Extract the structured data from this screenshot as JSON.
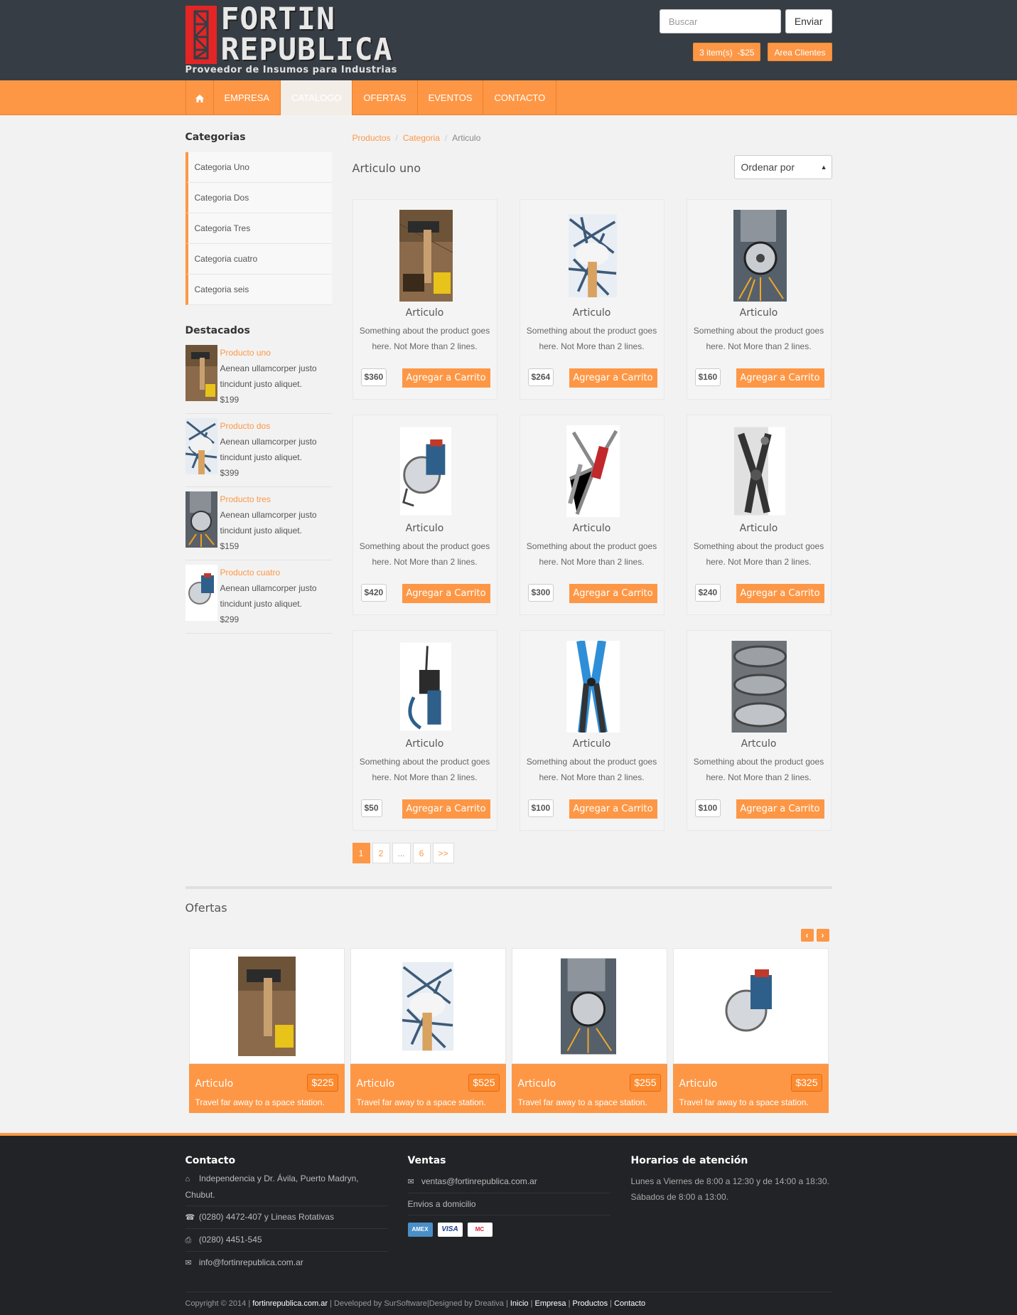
{
  "brand": {
    "name_line1": "FORTIN",
    "name_line2": "REPUBLICA",
    "tagline": "Proveedor de Insumos para Industrias"
  },
  "search": {
    "placeholder": "Buscar",
    "button": "Enviar"
  },
  "cart": {
    "label": "3 item(s)  -$25"
  },
  "clients_button": "Area Clientes",
  "nav": {
    "home_icon": "home-icon",
    "items": [
      "EMPRESA",
      "CATALOGO",
      "OFERTAS",
      "EVENTOS",
      "CONTACTO"
    ],
    "active": "CATALOGO"
  },
  "sidebar": {
    "categories_title": "Categorias",
    "categories": [
      "Categoria Uno",
      "Categoria Dos",
      "Categoria Tres",
      "Categoria cuatro",
      "Categoria seis"
    ],
    "featured_title": "Destacados",
    "featured": [
      {
        "name": "Producto uno",
        "desc": "Aenean ullamcorper justo tincidunt justo aliquet.",
        "price": "$199"
      },
      {
        "name": "Producto dos",
        "desc": "Aenean ullamcorper justo tincidunt justo aliquet.",
        "price": "$399"
      },
      {
        "name": "Producto tres",
        "desc": "Aenean ullamcorper justo tincidunt justo aliquet.",
        "price": "$159"
      },
      {
        "name": "Producto cuatro",
        "desc": "Aenean ullamcorper justo tincidunt justo aliquet.",
        "price": "$299"
      }
    ]
  },
  "breadcrumb": [
    "Productos",
    "Categoria",
    "Articulo"
  ],
  "page_title": "Articulo uno",
  "sort_label": "Ordenar por",
  "products": [
    {
      "title": "Articulo",
      "desc": "Something about the product goes here. Not More than 2 lines.",
      "price": "$360",
      "button": "Agregar a Carrito"
    },
    {
      "title": "Articulo",
      "desc": "Something about the product goes here. Not More than 2 lines.",
      "price": "$264",
      "button": "Agregar a Carrito"
    },
    {
      "title": "Articulo",
      "desc": "Something about the product goes here. Not More than 2 lines.",
      "price": "$160",
      "button": "Agregar a Carrito"
    },
    {
      "title": "Articulo",
      "desc": "Something about the product goes here. Not More than 2 lines.",
      "price": "$420",
      "button": "Agregar a Carrito"
    },
    {
      "title": "Articulo",
      "desc": "Something about the product goes here. Not More than 2 lines.",
      "price": "$300",
      "button": "Agregar a Carrito"
    },
    {
      "title": "Articulo",
      "desc": "Something about the product goes here. Not More than 2 lines.",
      "price": "$240",
      "button": "Agregar a Carrito"
    },
    {
      "title": "Articulo",
      "desc": "Something about the product goes here. Not More than 2 lines.",
      "price": "$50",
      "button": "Agregar a Carrito"
    },
    {
      "title": "Articulo",
      "desc": "Something about the product goes here. Not More than 2 lines.",
      "price": "$100",
      "button": "Agregar a Carrito"
    },
    {
      "title": "Artculo",
      "desc": "Something about the product goes here. Not More than 2 lines.",
      "price": "$100",
      "button": "Agregar a Carrito"
    }
  ],
  "pagination": [
    "1",
    "2",
    "...",
    "6",
    ">>"
  ],
  "offers": {
    "title": "Ofertas",
    "items": [
      {
        "name": "Articulo",
        "price": "$225",
        "desc": "Travel far away to a space station."
      },
      {
        "name": "Articulo",
        "price": "$525",
        "desc": "Travel far away to a space station."
      },
      {
        "name": "Articulo",
        "price": "$255",
        "desc": "Travel far away to a space station."
      },
      {
        "name": "Articulo",
        "price": "$325",
        "desc": "Travel far away to a space station."
      }
    ]
  },
  "footer": {
    "contact_title": "Contacto",
    "address": "Independencia y Dr. Ávila, Puerto Madryn, Chubut.",
    "phone1": "(0280) 4472-407 y Lineas Rotativas",
    "phone2": "(0280) 4451-545",
    "email": "info@fortinrepublica.com.ar",
    "sales_title": "Ventas",
    "sales_email": "ventas@fortinrepublica.com.ar",
    "shipping": "Envios a domicilio",
    "payment_cards": [
      "AMEX",
      "VISA",
      "MC"
    ],
    "hours_title": "Horarios de atención",
    "hours1": "Lunes a Viernes de 8:00 a 12:30 y de 14:00 a 18:30.",
    "hours2": "Sábados de 8:00 a 13:00.",
    "copyright_prefix": "Copyright © 2014 |",
    "copyright_site": "fortinrepublica.com.ar",
    "copyright_dev": "| Developed by SurSoftware|Designed by Dreativa |",
    "links": [
      "Inicio",
      "Empresa",
      "Productos",
      "Contacto"
    ]
  },
  "colors": {
    "accent": "#fd9746",
    "header_bg": "#373d44",
    "footer_bg": "#222326"
  }
}
